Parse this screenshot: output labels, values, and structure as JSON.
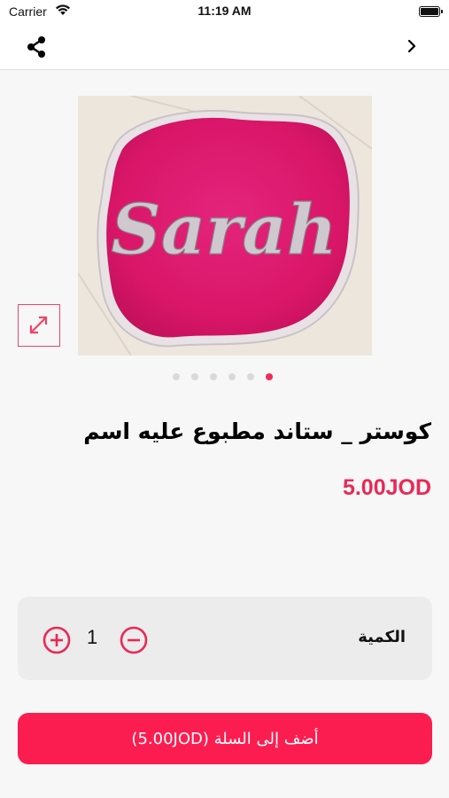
{
  "status_bar": {
    "carrier": "Carrier",
    "time": "11:19 AM"
  },
  "nav": {
    "share_icon": "share-icon",
    "back_icon": "chevron-right-icon"
  },
  "product": {
    "image_text": "Sarah",
    "title": "كوستر _ ستاند مطبوع عليه اسم",
    "price": "5.00JOD",
    "image_count": 6,
    "active_image": 6
  },
  "quantity": {
    "label": "الكمية",
    "value": "1"
  },
  "cta": {
    "label": "أضف إلى السلة (5.00JOD)"
  },
  "colors": {
    "accent": "#fb1d50",
    "price": "#ea2856",
    "dot_inactive": "#d9d9d9"
  }
}
